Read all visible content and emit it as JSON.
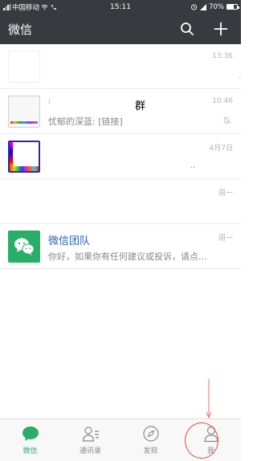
{
  "status_bar": {
    "carrier": "中国移动",
    "time": "15:11",
    "battery": "70%",
    "battery_level": 0.7
  },
  "header": {
    "title": "微信",
    "icons": [
      "search-icon",
      "plus-icon"
    ]
  },
  "chats": [
    {
      "name": "",
      "preview": "",
      "time": "13:36",
      "avatar": "blank"
    },
    {
      "name": "群",
      "preview": "忧郁的深蓝: [链接]",
      "time": "10:46",
      "muted": true,
      "avatar": "screenshot"
    },
    {
      "name": "",
      "preview": "..",
      "time": "4月7日",
      "avatar": "screenshot"
    },
    {
      "name": "",
      "preview": "",
      "time": "周一",
      "avatar": "none"
    },
    {
      "name": "微信团队",
      "preview": "你好，如果你有任何建议或投诉，请点...",
      "time": "周一",
      "avatar": "wechat-team"
    }
  ],
  "tabs": [
    {
      "label": "微信",
      "icon": "chat-bubble-icon",
      "active": true
    },
    {
      "label": "通讯录",
      "icon": "contacts-icon",
      "active": false
    },
    {
      "label": "发现",
      "icon": "compass-icon",
      "active": false
    },
    {
      "label": "我",
      "icon": "person-icon",
      "active": false
    }
  ],
  "colors": {
    "header_bg": "#393a3f",
    "accent_green": "#2aae67",
    "annotation_red": "#e04848"
  }
}
